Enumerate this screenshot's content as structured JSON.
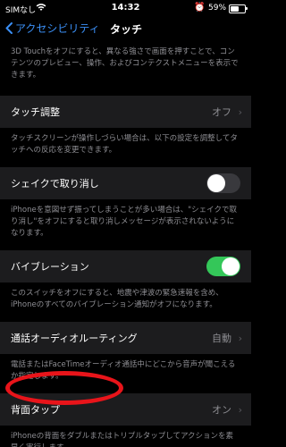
{
  "status_bar": {
    "carrier": "SIMなし",
    "time": "14:32",
    "battery_percent": "59%",
    "battery_level": 0.59,
    "icons": [
      "wifi-icon",
      "alarm-icon",
      "battery-icon"
    ]
  },
  "nav": {
    "back_label": "アクセシビリティ",
    "title": "タッチ"
  },
  "sections": {
    "top_desc": "3D Touchをオフにすると、異なる強さで画面を押すことで、コンテンツのプレビュー、操作、およびコンテクストメニューを表示できます。",
    "touch_adjust": {
      "label": "タッチ調整",
      "value": "オフ",
      "desc": "タッチスクリーンが操作しづらい場合は、以下の設定を調整してタッチへの反応を変更できます。"
    },
    "shake_undo": {
      "label": "シェイクで取り消し",
      "state": "off",
      "desc": "iPhoneを意図せず振ってしまうことが多い場合は、\"シェイクで取り消し\"をオフにすると取り消しメッセージが表示されないようになります。"
    },
    "vibration": {
      "label": "バイブレーション",
      "state": "on",
      "desc": "このスイッチをオフにすると、地震や津波の緊急速報を含め、iPhoneのすべてのバイブレーション通知がオフになります。"
    },
    "call_audio": {
      "label": "通話オーディオルーティング",
      "value": "自動",
      "desc": "電話またはFaceTimeオーディオ通話中にどこから音声が聞こえるか指定します。"
    },
    "back_tap": {
      "label": "背面タップ",
      "value": "オン",
      "desc": "iPhoneの背面をダブルまたはトリプルタップしてアクションを素早く実行します。"
    }
  },
  "chevron": "›",
  "colors": {
    "accent": "#3b8ff5",
    "cell_bg": "#1c1c1e",
    "toggle_on": "#34c759",
    "annotation": "#e8141a"
  }
}
